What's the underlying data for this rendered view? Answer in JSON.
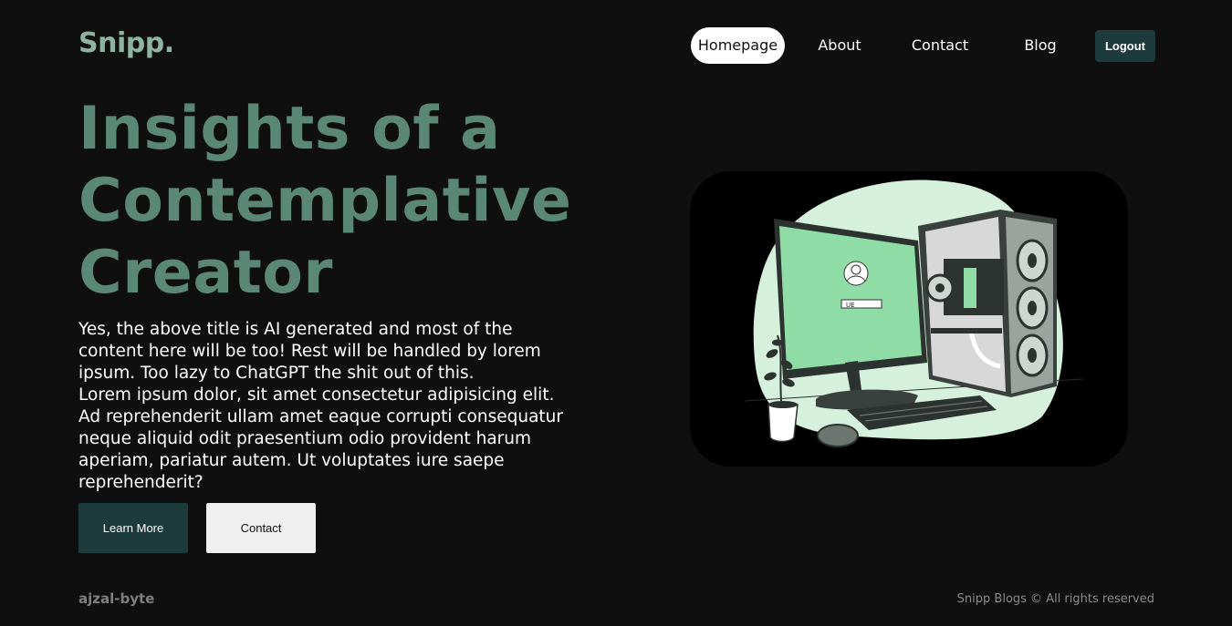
{
  "brand": {
    "logo": "Snipp."
  },
  "nav": {
    "items": [
      {
        "label": "Homepage",
        "active": true
      },
      {
        "label": "About",
        "active": false
      },
      {
        "label": "Contact",
        "active": false
      },
      {
        "label": "Blog",
        "active": false
      }
    ],
    "logout_label": "Logout"
  },
  "hero": {
    "title_lines": [
      "Insights of a",
      "Contemplative",
      "Creator"
    ],
    "description_lines": [
      "Yes, the above title is AI generated and most of the",
      "content here will be too! Rest will be handled by lorem",
      "ipsum. Too lazy to ChatGPT the shit out of this.",
      "Lorem ipsum dolor, sit amet consectetur adipisicing elit.",
      "Ad reprehenderit ullam amet eaque corrupti consequatur",
      "neque aliquid odit praesentium odio provident harum",
      "aperiam, pariatur autem. Ut voluptates iure saepe",
      "reprehenderit?"
    ],
    "primary_button": "Learn More",
    "secondary_button": "Contact"
  },
  "illustration": {
    "icon": "desktop-computer-illustration",
    "screen_label": "UE"
  },
  "footer": {
    "author": "ajzal-byte",
    "copyright": "Snipp Blogs © All rights reserved"
  },
  "colors": {
    "background": "#0f0f0f",
    "accent": "#5b8777",
    "logo": "#8fb3a2",
    "button_dark": "#1d3b3a",
    "button_light": "#efefef",
    "blob": "#d6f0de",
    "screen": "#8fdca6"
  }
}
